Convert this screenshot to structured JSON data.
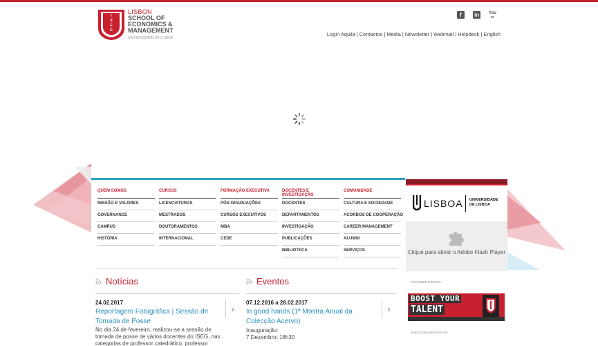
{
  "header": {
    "logo": {
      "line1": "LISBON",
      "line2": "SCHOOL OF",
      "line3": "ECONOMICS &",
      "line4": "MANAGEMENT",
      "line5": "UNIVERSIDADE DE LISBOA",
      "shield_text": "ISEG"
    },
    "social": [
      "facebook-icon",
      "linkedin-icon",
      "youtube-icon"
    ],
    "links": [
      "Login Aquila",
      "Contactos",
      "Media",
      "Newsletter",
      "Webmail",
      "Helpdesk",
      "English"
    ]
  },
  "menu": {
    "columns": [
      {
        "head": "QUEM SOMOS",
        "items": [
          "MISSÃO E VALORES",
          "GOVERNANCE",
          "CAMPUS",
          "HISTÓRIA"
        ]
      },
      {
        "head": "CURSOS",
        "items": [
          "LICENCIATURAS",
          "MESTRADOS",
          "DOUTORAMENTOS",
          "INTERNACIONAL"
        ]
      },
      {
        "head": "FORMAÇÃO EXECUTIVA",
        "items": [
          "PÓS-GRADUAÇÕES",
          "CURSOS EXECUTIVOS",
          "MBA",
          "CEDE"
        ]
      },
      {
        "head": "DOCENTES E INVESTIGAÇÃO",
        "items": [
          "DOCENTES",
          "DEPARTAMENTOS",
          "INVESTIGAÇÃO",
          "PUBLICAÇÕES",
          "BIBLIOTECA"
        ]
      },
      {
        "head": "COMUNIDADE",
        "items": [
          "CULTURA E SOCIEDADE",
          "ACORDOS DE COOPERAÇÃO",
          "CAREER MANAGEMENT",
          "ALUMNI",
          "SERVIÇOS"
        ]
      }
    ]
  },
  "news": {
    "title": "Notícias",
    "date": "24.02.2017",
    "headline": "Reportagem Fotográfica | Sessão de Tomada de Posse",
    "body": "No dia 24 de fevereiro, realizou-se a sessão de tomada de posse de vários docentes do ISEG, nas categorias de professor catedrático, professor"
  },
  "events": {
    "title": "Eventos",
    "date": "07.12.2016 a 28.02.2017",
    "headline": "In good hands (1ª Mostra Anual da Colecção Acervo)",
    "body_line1": "Inauguração:",
    "body_line2": "7 Dezembro: 18h30"
  },
  "sidebar": {
    "ulisboa_name": "LISBOA",
    "ulisboa_sub1": "UNIVERSIDADE",
    "ulisboa_sub2": "DE LISBOA",
    "flash_text": "Clique para ativar o Adobe Flash Player",
    "featured_label": "FEATURED EVENTS:",
    "talent_line1": "BOOST YOUR",
    "talent_line2": "TALENT",
    "exec_label": "EXECUTIVE EDUCATION:"
  },
  "colors": {
    "brand_red": "#c8202f",
    "accent_blue": "#2ba2c9",
    "link_blue": "#2a8fbd"
  }
}
